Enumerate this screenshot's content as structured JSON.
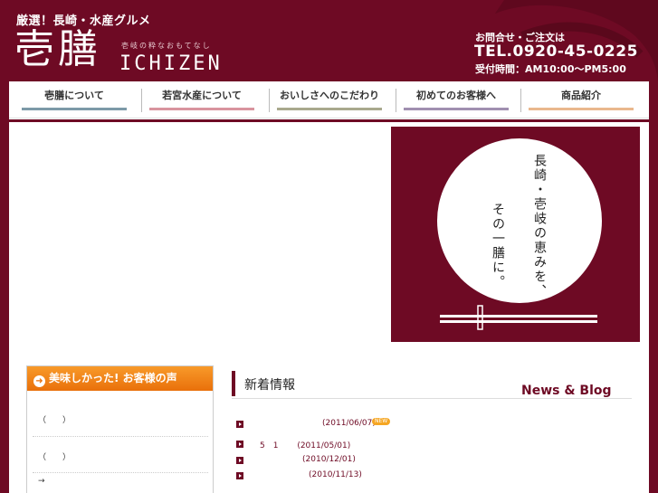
{
  "header": {
    "tagline": "厳選！長崎・水産グルメ",
    "logo_kanji": "壱膳",
    "logo_sub": "壱岐の粋なおもてなし",
    "logo_roman": "ICHIZEN",
    "contact_label": "お問合せ・ご注文は",
    "tel": "TEL.0920-45-0225",
    "hours": "受付時間：AM10:00～PM5:00"
  },
  "nav": {
    "items": [
      {
        "label": "壱膳について",
        "color": "#7d9aa8"
      },
      {
        "label": "若宮水産について",
        "color": "#d9949e"
      },
      {
        "label": "おいしさへのこだわり",
        "color": "#a9a98e"
      },
      {
        "label": "初めてのお客様へ",
        "color": "#a08fb0"
      },
      {
        "label": "商品紹介",
        "color": "#e9b88e"
      }
    ]
  },
  "hero": {
    "lines": [
      "長崎・壱岐の恵みを、",
      "その一膳に。"
    ]
  },
  "voice": {
    "title": "美味しかった! お客様の声",
    "lines": [
      "（　　）",
      "（　　）",
      "→"
    ]
  },
  "news": {
    "title": "新着情報",
    "subtitle": "News & Blog",
    "badge": "NEW",
    "items": [
      {
        "text": "(2011/06/07)"
      },
      {
        "text": "5　1　　 (2011/05/01)"
      },
      {
        "text": "(2010/12/01)"
      },
      {
        "text": "(2010/11/13)"
      }
    ]
  },
  "colors": {
    "maroon": "#6e0a24",
    "orange": "#e9700a"
  }
}
